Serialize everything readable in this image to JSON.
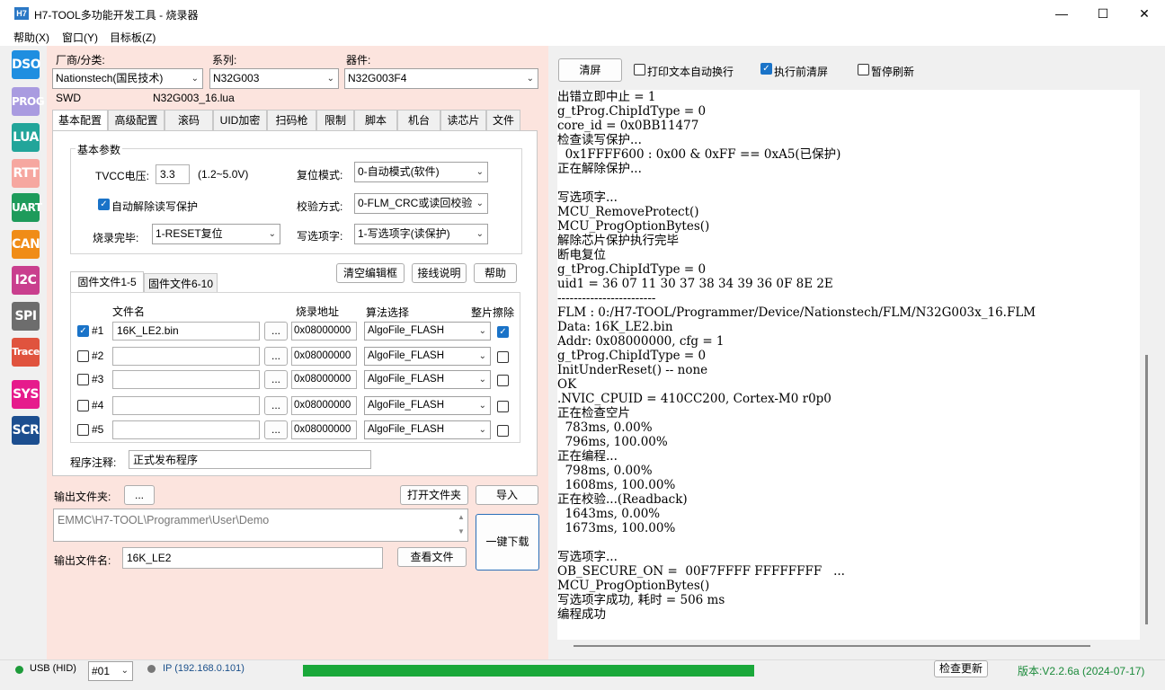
{
  "window": {
    "app_icon_text": "H7",
    "title": "H7-TOOL多功能开发工具 - 烧录器",
    "minimize": "—",
    "maximize": "☐",
    "close": "✕"
  },
  "menu": [
    "帮助(X)",
    "窗口(Y)",
    "目标板(Z)"
  ],
  "sidebar": [
    {
      "label": "DSO",
      "color": "#1f8ee0"
    },
    {
      "label": "PROG",
      "color": "#a99be0"
    },
    {
      "label": "LUA",
      "color": "#22a59a"
    },
    {
      "label": "RTT",
      "color": "#f6a7a0"
    },
    {
      "label": "UART",
      "color": "#1e9b5b"
    },
    {
      "label": "CAN",
      "color": "#f08c17"
    },
    {
      "label": "I2C",
      "color": "#c93f8e"
    },
    {
      "label": "SPI",
      "color": "#6d6d6d"
    },
    {
      "label": "Trace",
      "color": "#e0533e"
    },
    {
      "label": "SYS",
      "color": "#e61b8c"
    },
    {
      "label": "SCR",
      "color": "#1c4e8f"
    }
  ],
  "selector": {
    "vendor_label": "厂商/分类:",
    "vendor_value": "Nationstech(国民技术)",
    "series_label": "系列:",
    "series_value": "N32G003",
    "device_label": "器件:",
    "device_value": "N32G003F4",
    "interface": "SWD",
    "lua_file": "N32G003_16.lua"
  },
  "tabs": [
    "基本配置",
    "高级配置",
    "滚码",
    "UID加密",
    "扫码枪",
    "限制",
    "脚本",
    "机台",
    "读芯片",
    "文件"
  ],
  "basic": {
    "group_title": "基本参数",
    "tvcc_label": "TVCC电压:",
    "tvcc_value": "3.3",
    "tvcc_range": "(1.2~5.0V)",
    "reset_mode_label": "复位模式:",
    "reset_mode_value": "0-自动模式(软件)",
    "auto_unlock_label": "自动解除读写保护",
    "verify_label": "校验方式:",
    "verify_value": "0-FLM_CRC或读回校验",
    "finish_label": "烧录完毕:",
    "finish_value": "1-RESET复位",
    "option_label": "写选项字:",
    "option_value": "1-写选项字(读保护)"
  },
  "file_buttons": {
    "clear": "清空编辑框",
    "wiring": "接线说明",
    "help": "帮助"
  },
  "file_tabs": [
    "固件文件1-5",
    "固件文件6-10"
  ],
  "file_table": {
    "headers": {
      "file": "文件名",
      "addr": "烧录地址",
      "algo": "算法选择",
      "erase": "整片擦除"
    },
    "browse": "...",
    "rows": [
      {
        "id": "#1",
        "checked": true,
        "file": "16K_LE2.bin",
        "addr": "0x08000000",
        "algo": "AlgoFile_FLASH",
        "erase": true
      },
      {
        "id": "#2",
        "checked": false,
        "file": "",
        "addr": "0x08000000",
        "algo": "AlgoFile_FLASH",
        "erase": false
      },
      {
        "id": "#3",
        "checked": false,
        "file": "",
        "addr": "0x08000000",
        "algo": "AlgoFile_FLASH",
        "erase": false
      },
      {
        "id": "#4",
        "checked": false,
        "file": "",
        "addr": "0x08000000",
        "algo": "AlgoFile_FLASH",
        "erase": false
      },
      {
        "id": "#5",
        "checked": false,
        "file": "",
        "addr": "0x08000000",
        "algo": "AlgoFile_FLASH",
        "erase": false
      }
    ]
  },
  "note": {
    "label": "程序注释:",
    "value": "正式发布程序"
  },
  "output": {
    "folder_label": "输出文件夹:",
    "folder_btn": "...",
    "open_folder": "打开文件夹",
    "import": "导入",
    "path": "EMMC\\H7-TOOL\\Programmer\\User\\Demo",
    "one_key": "一键下载",
    "name_label": "输出文件名:",
    "name_value": "16K_LE2",
    "view_file": "查看文件"
  },
  "console_toolbar": {
    "clear": "清屏",
    "wrap_label": "打印文本自动换行",
    "wrap_checked": false,
    "clear_before_label": "执行前清屏",
    "clear_before_checked": true,
    "pause_label": "暂停刷新",
    "pause_checked": false
  },
  "console_lines": [
    "出错立即中止 = 1",
    "g_tProg.ChipIdType = 0",
    "core_id = 0x0BB11477",
    "检查读写保护...",
    "  0x1FFFF600 : 0x00 & 0xFF == 0xA5(已保护)",
    "正在解除保护...",
    "",
    "写选项字...",
    "MCU_RemoveProtect()",
    "MCU_ProgOptionBytes()",
    "解除芯片保护执行完毕",
    "断电复位",
    "g_tProg.ChipIdType = 0",
    "uid1 = 36 07 11 30 37 38 34 39 36 0F 8E 2E",
    "------------------------",
    "FLM : 0:/H7-TOOL/Programmer/Device/Nationstech/FLM/N32G003x_16.FLM",
    "Data: 16K_LE2.bin",
    "Addr: 0x08000000, cfg = 1",
    "g_tProg.ChipIdType = 0",
    "InitUnderReset() -- none",
    "OK",
    ".NVIC_CPUID = 410CC200, Cortex-M0 r0p0",
    "正在检查空片",
    "  783ms, 0.00%",
    "  796ms, 100.00%",
    "正在编程...",
    "  798ms, 0.00%",
    "  1608ms, 100.00%",
    "正在校验...(Readback)",
    "  1643ms, 0.00%",
    "  1673ms, 100.00%",
    "",
    "写选项字...",
    "OB_SECURE_ON =  00F7FFFF FFFFFFFF   ...",
    "MCU_ProgOptionBytes()",
    "写选项字成功, 耗时 = 506 ms",
    "编程成功"
  ],
  "status": {
    "usb": "USB (HID)",
    "usb_color": "#1e9b3a",
    "device_no": "#01",
    "ip": "IP (192.168.0.101)",
    "ip_color": "#777777",
    "progress": 1.0,
    "progress_color": "#1aa83a",
    "check_update": "检查更新",
    "version": "版本:V2.2.6a (2024-07-17)",
    "version_color": "#1a8a3a"
  }
}
